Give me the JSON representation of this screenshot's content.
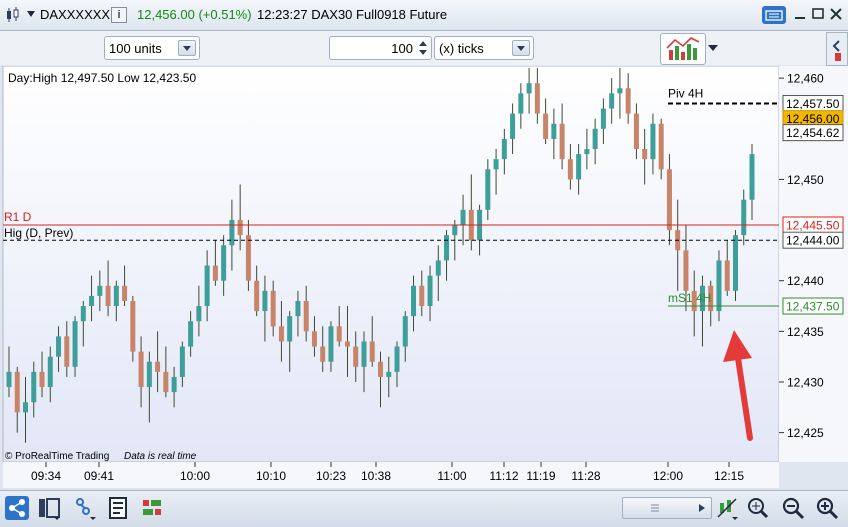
{
  "titlebar": {
    "instrument": "DAXXXXXX",
    "info_icon": "info-icon",
    "price": "12,456.00 (+0.51%)",
    "price_color": "#128c12",
    "time_desc": "12:23:27 DAX30 Full0918 Future"
  },
  "toolbar": {
    "units_value": "100 units",
    "ticks_count": "100",
    "ticks_unit": "(x) ticks"
  },
  "chart_data": {
    "type": "candlestick",
    "info_label": "Day:High 12,497.50 Low 12,423.50",
    "copyright": "© ProRealTime Trading",
    "realtime_note": "Data is real time",
    "x_tick_labels": [
      "09:34",
      "09:41",
      "10:00",
      "10:10",
      "10:23",
      "10:38",
      "11:00",
      "11:12",
      "11:19",
      "11:28",
      "12:00",
      "12:15"
    ],
    "y_tick_labels": [
      "12,460",
      "12,450",
      "12,440",
      "12,435",
      "12,430",
      "12,425"
    ],
    "y_ticks": [
      12460,
      12450,
      12440,
      12435,
      12430,
      12425
    ],
    "ylim": [
      12422.1,
      12461.2
    ],
    "up_color": "#3e9e9a",
    "down_color": "#c88468",
    "levels": [
      {
        "name": "R1 D",
        "value": 12445.5,
        "label": "12,445.50",
        "color": "#d92020",
        "style": "solid",
        "text_color": "#d92020"
      },
      {
        "name": "Hig (D, Prev)",
        "value": 12444.0,
        "label": "12,444.00",
        "color": "#000000",
        "style": "dashed",
        "text_color": "#000000"
      },
      {
        "name": "Piv 4H",
        "value": 12457.5,
        "label": "12,457.50",
        "color": "#000000",
        "style": "dashed",
        "text_color": "#000000"
      },
      {
        "name": "mS1 4H",
        "value": 12437.5,
        "label": "12,437.50",
        "color": "#2e8b2e",
        "style": "solid",
        "text_color": "#2e8b2e"
      }
    ],
    "last_price": {
      "value": 12456.0,
      "label": "12,456.00",
      "bg": "#f2b800"
    },
    "other_price": {
      "value": 12454.62,
      "label": "12,454.62"
    },
    "candles": [
      [
        12429.5,
        12433.5,
        12428.5,
        12431.0
      ],
      [
        12431.0,
        12431.5,
        12425.0,
        12427.0
      ],
      [
        12427.0,
        12430.5,
        12424.0,
        12428.0
      ],
      [
        12428.0,
        12432.0,
        12426.5,
        12431.0
      ],
      [
        12431.0,
        12433.0,
        12428.5,
        12429.5
      ],
      [
        12429.5,
        12433.5,
        12428.0,
        12432.5
      ],
      [
        12432.5,
        12435.5,
        12431.0,
        12434.5
      ],
      [
        12434.5,
        12436.0,
        12430.5,
        12431.5
      ],
      [
        12431.5,
        12436.5,
        12430.5,
        12436.0
      ],
      [
        12436.0,
        12438.0,
        12433.5,
        12437.5
      ],
      [
        12437.5,
        12440.5,
        12436.0,
        12438.5
      ],
      [
        12438.5,
        12441.0,
        12437.0,
        12439.5
      ],
      [
        12439.5,
        12442.0,
        12436.5,
        12437.5
      ],
      [
        12437.5,
        12440.0,
        12436.0,
        12439.5
      ],
      [
        12439.5,
        12441.5,
        12437.5,
        12438.0
      ],
      [
        12438.0,
        12438.5,
        12432.0,
        12433.0
      ],
      [
        12433.0,
        12434.5,
        12427.5,
        12429.5
      ],
      [
        12429.5,
        12433.0,
        12426.0,
        12432.0
      ],
      [
        12432.0,
        12435.0,
        12429.0,
        12431.0
      ],
      [
        12431.0,
        12433.5,
        12428.5,
        12429.0
      ],
      [
        12429.0,
        12431.5,
        12427.5,
        12430.5
      ],
      [
        12430.5,
        12434.0,
        12429.5,
        12433.5
      ],
      [
        12433.5,
        12437.0,
        12432.5,
        12436.0
      ],
      [
        12436.0,
        12439.5,
        12434.5,
        12437.5
      ],
      [
        12437.5,
        12443.0,
        12436.0,
        12441.5
      ],
      [
        12441.5,
        12444.0,
        12439.5,
        12440.0
      ],
      [
        12440.0,
        12444.5,
        12438.5,
        12443.5
      ],
      [
        12443.5,
        12448.0,
        12441.0,
        12446.0
      ],
      [
        12446.0,
        12449.5,
        12443.0,
        12444.5
      ],
      [
        12444.5,
        12446.0,
        12439.0,
        12440.0
      ],
      [
        12440.0,
        12441.5,
        12436.5,
        12437.0
      ],
      [
        12437.0,
        12440.5,
        12434.0,
        12439.0
      ],
      [
        12439.0,
        12440.0,
        12434.5,
        12435.5
      ],
      [
        12435.5,
        12438.0,
        12432.0,
        12434.0
      ],
      [
        12434.0,
        12437.0,
        12431.0,
        12436.5
      ],
      [
        12436.5,
        12439.0,
        12434.5,
        12438.0
      ],
      [
        12438.0,
        12439.5,
        12434.0,
        12435.0
      ],
      [
        12435.0,
        12436.5,
        12432.5,
        12433.5
      ],
      [
        12433.5,
        12435.5,
        12431.0,
        12432.0
      ],
      [
        12432.0,
        12436.0,
        12431.0,
        12435.5
      ],
      [
        12435.5,
        12437.5,
        12433.5,
        12434.0
      ],
      [
        12434.0,
        12437.5,
        12430.5,
        12433.5
      ],
      [
        12433.5,
        12435.0,
        12430.0,
        12431.5
      ],
      [
        12431.5,
        12435.0,
        12429.0,
        12434.0
      ],
      [
        12434.0,
        12436.5,
        12431.5,
        12432.0
      ],
      [
        12432.0,
        12433.0,
        12427.5,
        12430.5
      ],
      [
        12430.5,
        12432.5,
        12428.5,
        12431.0
      ],
      [
        12431.0,
        12434.0,
        12429.5,
        12433.5
      ],
      [
        12433.5,
        12437.0,
        12432.0,
        12436.5
      ],
      [
        12436.5,
        12440.5,
        12435.0,
        12439.5
      ],
      [
        12439.5,
        12441.0,
        12436.5,
        12437.5
      ],
      [
        12437.5,
        12441.5,
        12436.0,
        12440.5
      ],
      [
        12440.5,
        12443.5,
        12438.0,
        12442.0
      ],
      [
        12442.0,
        12445.0,
        12440.0,
        12444.5
      ],
      [
        12444.5,
        12446.0,
        12442.0,
        12445.5
      ],
      [
        12445.5,
        12448.5,
        12443.5,
        12447.0
      ],
      [
        12447.0,
        12450.5,
        12443.0,
        12444.0
      ],
      [
        12444.0,
        12447.5,
        12442.5,
        12447.0
      ],
      [
        12447.0,
        12452.0,
        12446.0,
        12451.0
      ],
      [
        12451.0,
        12453.0,
        12448.5,
        12452.0
      ],
      [
        12452.0,
        12455.0,
        12450.5,
        12454.0
      ],
      [
        12454.0,
        12457.5,
        12452.5,
        12456.5
      ],
      [
        12456.5,
        12459.5,
        12455.0,
        12458.5
      ],
      [
        12458.5,
        12461.0,
        12456.5,
        12459.5
      ],
      [
        12459.5,
        12461.0,
        12455.5,
        12456.5
      ],
      [
        12456.5,
        12458.0,
        12453.5,
        12454.0
      ],
      [
        12454.0,
        12457.0,
        12452.0,
        12455.5
      ],
      [
        12455.5,
        12457.5,
        12451.0,
        12452.0
      ],
      [
        12452.0,
        12453.5,
        12449.0,
        12450.0
      ],
      [
        12450.0,
        12453.5,
        12448.5,
        12452.5
      ],
      [
        12452.5,
        12455.0,
        12451.0,
        12453.0
      ],
      [
        12453.0,
        12456.0,
        12451.5,
        12455.0
      ],
      [
        12455.0,
        12458.0,
        12453.5,
        12457.0
      ],
      [
        12457.0,
        12460.0,
        12455.5,
        12458.5
      ],
      [
        12458.5,
        12461.0,
        12456.0,
        12459.0
      ],
      [
        12459.0,
        12460.5,
        12455.5,
        12456.5
      ],
      [
        12456.5,
        12457.5,
        12452.0,
        12453.0
      ],
      [
        12453.0,
        12455.0,
        12449.5,
        12452.0
      ],
      [
        12452.0,
        12456.5,
        12450.5,
        12455.5
      ],
      [
        12455.5,
        12456.0,
        12450.0,
        12451.0
      ],
      [
        12451.0,
        12452.5,
        12443.5,
        12445.0
      ],
      [
        12445.0,
        12448.0,
        12439.0,
        12443.0
      ],
      [
        12443.0,
        12445.5,
        12437.0,
        12439.0
      ],
      [
        12439.0,
        12441.0,
        12434.5,
        12437.0
      ],
      [
        12437.0,
        12440.5,
        12433.5,
        12439.5
      ],
      [
        12439.5,
        12440.0,
        12435.5,
        12437.0
      ],
      [
        12437.0,
        12443.0,
        12436.0,
        12442.0
      ],
      [
        12442.0,
        12444.0,
        12438.5,
        12439.0
      ],
      [
        12439.0,
        12445.0,
        12438.0,
        12444.5
      ],
      [
        12444.5,
        12449.0,
        12443.5,
        12448.0
      ],
      [
        12448.0,
        12453.5,
        12446.0,
        12452.5
      ]
    ]
  },
  "bottombar": {
    "icons": [
      "share-icon",
      "window-layout-icon",
      "drawing-tool-icon",
      "indicator-icon",
      "chart-style-icon",
      "scroll-left-icon",
      "scroll-right-icon",
      "auto-scale-icon",
      "fit-screen-icon",
      "zoom-out-icon",
      "zoom-in-icon"
    ]
  }
}
